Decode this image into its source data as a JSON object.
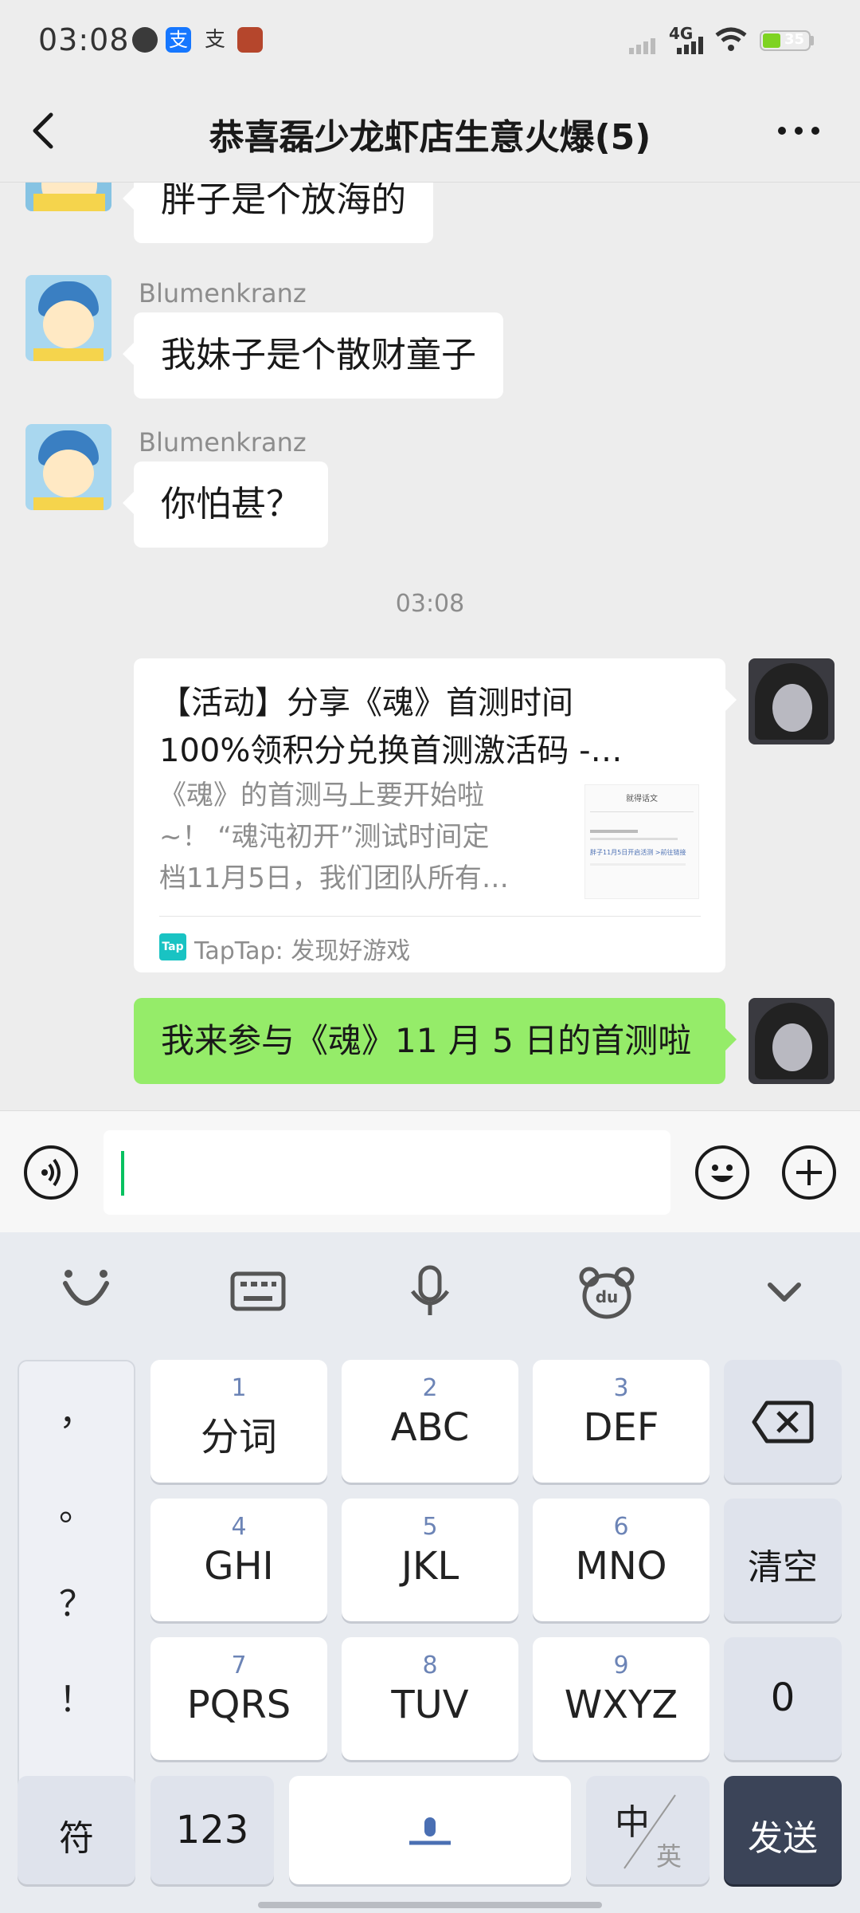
{
  "status_bar": {
    "time": "03:08",
    "network": "4G",
    "battery": "35"
  },
  "nav": {
    "title": "恭喜磊少龙虾店生意火爆(5)"
  },
  "messages": [
    {
      "text": "胖子是个放海的"
    },
    {
      "sender": "Blumenkranz",
      "text": "我妹子是个散财童子"
    },
    {
      "sender": "Blumenkranz",
      "text": "你怕甚？"
    }
  ],
  "timestamp": "03:08",
  "link_card": {
    "title_line1": "【活动】分享《魂》首测时间",
    "title_line2": "100%领积分兑换首测激活码 -…",
    "desc_line1": "《魂》的首测马上要开始啦",
    "desc_line2": "~！ “魂沌初开”测试时间定",
    "desc_line3": "档11月5日，我们团队所有…",
    "thumb_heading": "就得话文",
    "thumb_text": "胖子11月5日开启活测 >前往链接",
    "source_badge": "Tap",
    "source": "TapTap: 发现好游戏"
  },
  "outgoing": {
    "text": "我来参与《魂》11 月 5 日的首测啦"
  },
  "keyboard": {
    "punct": [
      "，",
      "。",
      "？",
      "！"
    ],
    "rows": [
      [
        {
          "num": "1",
          "label": "分词"
        },
        {
          "num": "2",
          "label": "ABC"
        },
        {
          "num": "3",
          "label": "DEF"
        }
      ],
      [
        {
          "num": "4",
          "label": "GHI"
        },
        {
          "num": "5",
          "label": "JKL"
        },
        {
          "num": "6",
          "label": "MNO"
        }
      ],
      [
        {
          "num": "7",
          "label": "PQRS"
        },
        {
          "num": "8",
          "label": "TUV"
        },
        {
          "num": "9",
          "label": "WXYZ"
        }
      ]
    ],
    "clear": "清空",
    "zero": "0",
    "symbol": "符",
    "numbers": "123",
    "lang_zh": "中",
    "lang_en": "英",
    "send": "发送"
  },
  "colors": {
    "outgoing_bubble": "#95ec69",
    "background": "#ededed",
    "send_key": "#3b4458",
    "cursor": "#07c160"
  }
}
